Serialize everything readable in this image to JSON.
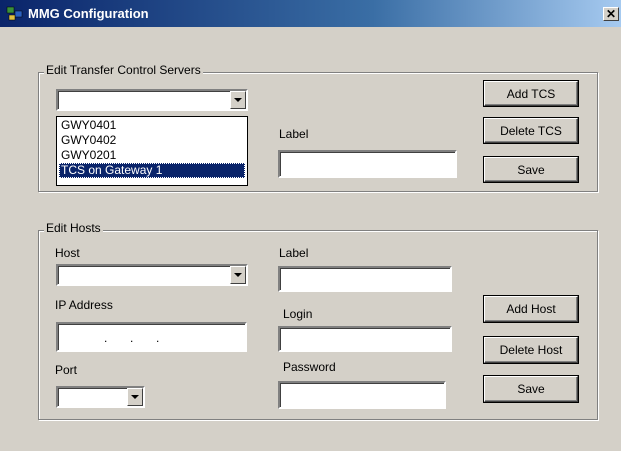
{
  "window": {
    "title": "MMG Configuration",
    "close_glyph": "✕"
  },
  "tcs_section": {
    "legend": "Edit Transfer Control Servers",
    "dropdown_value": "",
    "list_items": [
      "GWY0401",
      "GWY0402",
      "GWY0201",
      "TCS on Gateway 1"
    ],
    "selected_index": 3,
    "label_caption": "Label",
    "label_value": "",
    "add_button": "Add TCS",
    "delete_button": "Delete TCS",
    "save_button": "Save"
  },
  "hosts_section": {
    "legend": "Edit Hosts",
    "host_caption": "Host",
    "host_value": "",
    "ip_caption": "IP Address",
    "ip_dots": ".     .     .",
    "port_caption": "Port",
    "port_value": "",
    "label_caption": "Label",
    "label_value": "",
    "login_caption": "Login",
    "login_value": "",
    "password_caption": "Password",
    "password_value": "",
    "add_button": "Add Host",
    "delete_button": "Delete Host",
    "save_button": "Save"
  }
}
